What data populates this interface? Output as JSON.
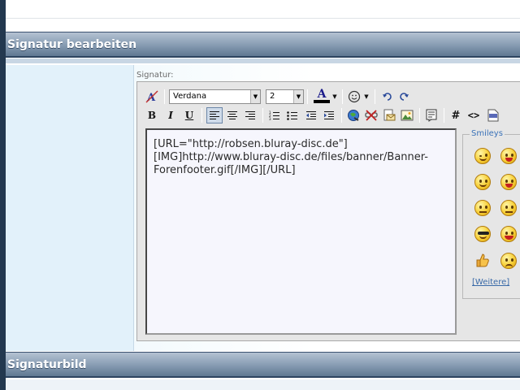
{
  "sections": {
    "signature_header": "Signatur bearbeiten",
    "signature_image_header": "Signaturbild"
  },
  "editor": {
    "label": "Signatur:",
    "font": "Verdana",
    "size": "2",
    "content": "[URL=\"http://robsen.bluray-disc.de\"][IMG]http://www.bluray-disc.de/files/banner/Banner-Forenfooter.gif[/IMG][/URL]"
  },
  "toolbar": {
    "row1_icons": [
      "remove-format-icon",
      "font-select",
      "size-select",
      "text-color-icon",
      "smiley-menu-icon",
      "undo-icon",
      "redo-icon"
    ],
    "row2_icons": [
      "bold-icon",
      "italic-icon",
      "underline-icon",
      "align-left-icon",
      "align-center-icon",
      "align-right-icon",
      "ordered-list-icon",
      "unordered-list-icon",
      "outdent-icon",
      "indent-icon",
      "insert-link-icon",
      "remove-link-icon",
      "insert-email-icon",
      "insert-image-icon",
      "quote-icon",
      "code-hash-icon",
      "html-icon",
      "php-icon"
    ],
    "bold": "B",
    "italic": "I",
    "underline": "U",
    "text_color": "A",
    "hash": "#",
    "html": "<>"
  },
  "smileys": {
    "legend": "Smileys",
    "more_link": "[Weitere]"
  },
  "colors": {
    "header_gradient_top": "#b4c2d2",
    "header_gradient_bottom": "#5f7892",
    "outer_background": "#23384f",
    "text_color_bar": "#000000",
    "smiley_legend": "#3a72b8"
  }
}
